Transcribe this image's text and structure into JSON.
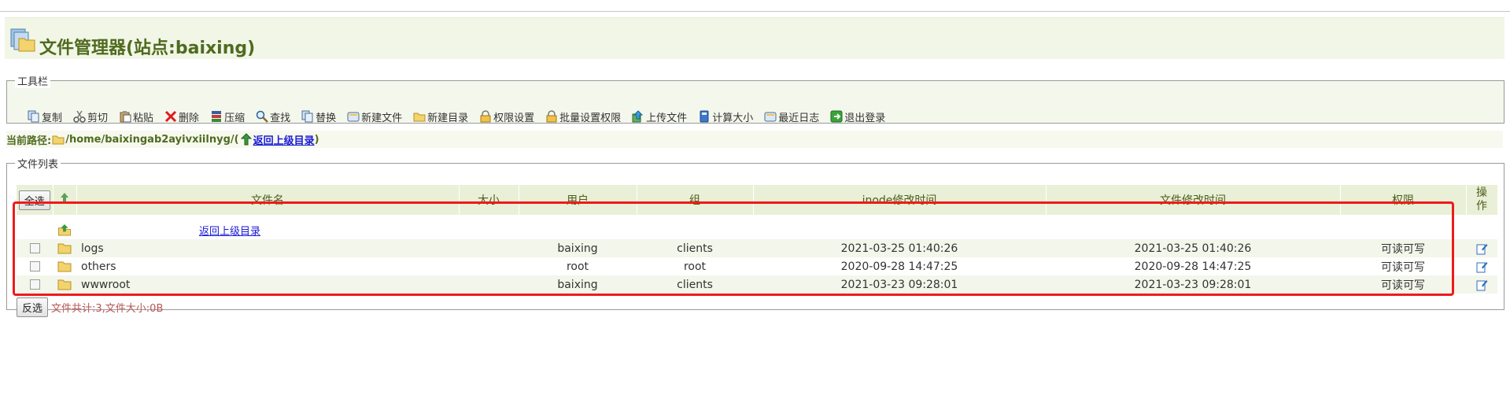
{
  "app": {
    "title": "文件管理器(站点:baixing)"
  },
  "toolbar": {
    "legend": "工具栏",
    "buttons": [
      {
        "label": "复制",
        "icon": "copy-icon"
      },
      {
        "label": "剪切",
        "icon": "cut-icon"
      },
      {
        "label": "粘贴",
        "icon": "paste-icon"
      },
      {
        "label": "删除",
        "icon": "delete-icon"
      },
      {
        "label": "压缩",
        "icon": "compress-icon"
      },
      {
        "label": "查找",
        "icon": "search-icon"
      },
      {
        "label": "替换",
        "icon": "replace-icon"
      },
      {
        "label": "新建文件",
        "icon": "new-file-icon"
      },
      {
        "label": "新建目录",
        "icon": "new-folder-icon"
      },
      {
        "label": "权限设置",
        "icon": "lock-icon"
      },
      {
        "label": "批量设置权限",
        "icon": "lock-icon"
      },
      {
        "label": "上传文件",
        "icon": "upload-icon"
      },
      {
        "label": "计算大小",
        "icon": "calculator-icon"
      },
      {
        "label": "最近日志",
        "icon": "log-icon"
      },
      {
        "label": "退出登录",
        "icon": "logout-icon"
      }
    ]
  },
  "path": {
    "label": "当前路径:",
    "value": "/home/baixingab2ayivxiilnyg/",
    "open_paren": "(",
    "up_link": "返回上级目录",
    "close_paren": ")"
  },
  "files": {
    "legend": "文件列表",
    "select_all": "全选",
    "headers": {
      "name": "文件名",
      "size": "大小",
      "user": "用户",
      "group": "组",
      "inode_time": "inode修改时间",
      "file_time": "文件修改时间",
      "perm": "权限",
      "action": "操作"
    },
    "up_row_label": "返回上级目录",
    "rows": [
      {
        "name": "logs",
        "size": "",
        "user": "baixing",
        "group": "clients",
        "inode_time": "2021-03-25 01:40:26",
        "file_time": "2021-03-25 01:40:26",
        "perm": "可读可写"
      },
      {
        "name": "others",
        "size": "",
        "user": "root",
        "group": "root",
        "inode_time": "2020-09-28 14:47:25",
        "file_time": "2020-09-28 14:47:25",
        "perm": "可读可写"
      },
      {
        "name": "wwwroot",
        "size": "",
        "user": "baixing",
        "group": "clients",
        "inode_time": "2021-03-23 09:28:01",
        "file_time": "2021-03-23 09:28:01",
        "perm": "可读可写"
      }
    ],
    "invert_select": "反选",
    "summary": "文件共计:3,文件大小:0B"
  },
  "colors": {
    "title": "#4f6b1f",
    "header_bg": "#e9f0d7",
    "highlight": "#ee1b1b",
    "link": "#1a1ad6"
  }
}
